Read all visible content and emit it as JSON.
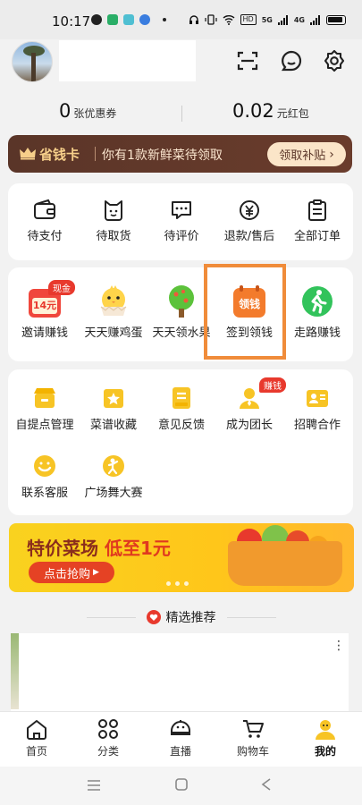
{
  "status": {
    "time": "10:17",
    "network": "5G",
    "hd_label": "HD",
    "signal2": "4G"
  },
  "balance": {
    "coupons_value": "0",
    "coupons_unit": "张优惠券",
    "redpacket_value": "0.02",
    "redpacket_unit": "元红包"
  },
  "promo": {
    "title": "省钱卡",
    "text": "你有1款新鲜菜待领取",
    "button": "领取补贴"
  },
  "orders": [
    {
      "label": "待支付",
      "icon": "wallet-icon"
    },
    {
      "label": "待取货",
      "icon": "bag-icon"
    },
    {
      "label": "待评价",
      "icon": "chat-dots-icon"
    },
    {
      "label": "退款/售后",
      "icon": "yen-refund-icon"
    },
    {
      "label": "全部订单",
      "icon": "clipboard-icon"
    }
  ],
  "earn": [
    {
      "label": "邀请赚钱",
      "badge": "现金",
      "icon_text": "14元",
      "icon": "calendar-cash-icon"
    },
    {
      "label": "天天赚鸡蛋",
      "icon": "chick-icon"
    },
    {
      "label": "天天领水果",
      "icon": "tree-icon"
    },
    {
      "label": "签到领钱",
      "icon_text": "领钱",
      "icon": "signin-calendar-icon"
    },
    {
      "label": "走路赚钱",
      "icon": "walking-icon"
    }
  ],
  "tools": [
    {
      "label": "自提点管理",
      "icon": "store-icon"
    },
    {
      "label": "菜谱收藏",
      "icon": "star-box-icon"
    },
    {
      "label": "意见反馈",
      "icon": "feedback-icon"
    },
    {
      "label": "成为团长",
      "badge": "赚钱",
      "icon": "leader-icon"
    },
    {
      "label": "招聘合作",
      "icon": "id-card-icon"
    },
    {
      "label": "联系客服",
      "icon": "smile-icon"
    },
    {
      "label": "广场舞大赛",
      "icon": "dance-icon"
    }
  ],
  "banner": {
    "title_a": "特价菜场",
    "title_b": "低至1元",
    "button": "点击抢购"
  },
  "recommend": {
    "title": "精选推荐"
  },
  "tabs": [
    {
      "label": "首页",
      "icon": "home-icon"
    },
    {
      "label": "分类",
      "icon": "category-icon"
    },
    {
      "label": "直播",
      "icon": "live-icon"
    },
    {
      "label": "购物车",
      "icon": "cart-icon"
    },
    {
      "label": "我的",
      "icon": "profile-icon",
      "active": true
    }
  ],
  "colors": {
    "accent": "#e8392d",
    "brand_brown": "#5a3528",
    "highlight": "#f08c3a",
    "yellow": "#f7c425"
  }
}
